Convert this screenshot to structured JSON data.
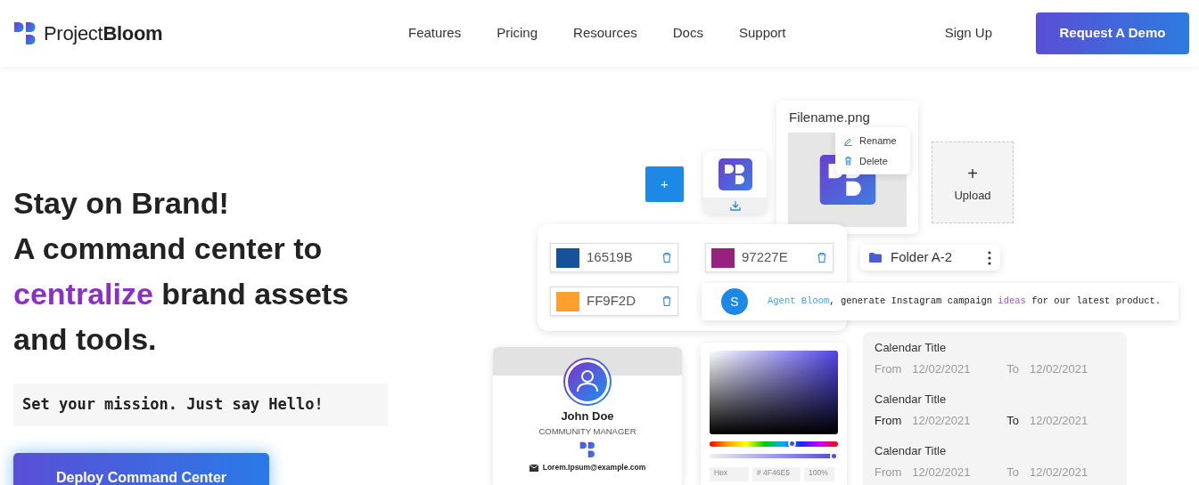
{
  "brand": {
    "name": "Project**Bloom**"
  },
  "nav": {
    "links": [
      {
        "label": "Features"
      },
      {
        "label": "Pricing"
      },
      {
        "label": "Resources"
      },
      {
        "label": "Docs"
      },
      {
        "label": "Support"
      }
    ],
    "sign_up": "Sign Up",
    "cta": "Request A Demo"
  },
  "hero": {
    "heading": {
      "lines_before": [
        "Stay on Brand!",
        "A command center to"
      ],
      "highlight": "centralize",
      "after_highlight": " brand assets",
      "lines_after": [
        "and tools."
      ]
    },
    "mission": "Set your mission. Just say Hello!",
    "cta": "Deploy Command Center"
  },
  "collage": {
    "add_tile": {
      "symbol": "+"
    },
    "file_card": {
      "filename": "Filename.png",
      "menu": [
        {
          "label": "Rename",
          "kind": "rename"
        },
        {
          "label": "Delete",
          "kind": "delete"
        }
      ]
    },
    "upload": {
      "symbol": "+",
      "label": "Upload"
    },
    "swatches": [
      {
        "code": "16519B",
        "color": "#16519b"
      },
      {
        "code": "97227E",
        "color": "#97227e"
      },
      {
        "code": "FF9F2D",
        "color": "#ff9f2d"
      }
    ],
    "folder": {
      "name": "Folder A-2"
    },
    "chat": {
      "avatar": "S",
      "parts": [
        {
          "text": "Agent Bloom",
          "kind": "mention"
        },
        {
          "text": ", generate Instagram campaign ",
          "kind": "plain"
        },
        {
          "text": "ideas",
          "kind": "keyword"
        },
        {
          "text": " for our latest product.",
          "kind": "plain"
        }
      ]
    },
    "profile": {
      "name": "John Doe",
      "role": "COMMUNITY MANAGER",
      "email": "Lorem.Ipsum@example.com"
    },
    "picker": {
      "hue_slider": {
        "level": 0.65
      },
      "alpha_slider": {
        "level": 1
      },
      "mode": "Hex",
      "hex": "# 4F46E5",
      "opacity": "100%"
    },
    "calendar": [
      {
        "title": "Calendar Title",
        "from_label": "From",
        "from": "12/02/2021",
        "to_label": "To",
        "to": "12/02/2021",
        "highlighted": false
      },
      {
        "title": "Calendar Title",
        "from_label": "From",
        "from": "12/02/2021",
        "to_label": "To",
        "to": "12/02/2021",
        "highlighted": true
      },
      {
        "title": "Calendar Title",
        "from_label": "From",
        "from": "12/02/2021",
        "to_label": "To",
        "to": "12/02/2021",
        "highlighted": false
      }
    ]
  }
}
